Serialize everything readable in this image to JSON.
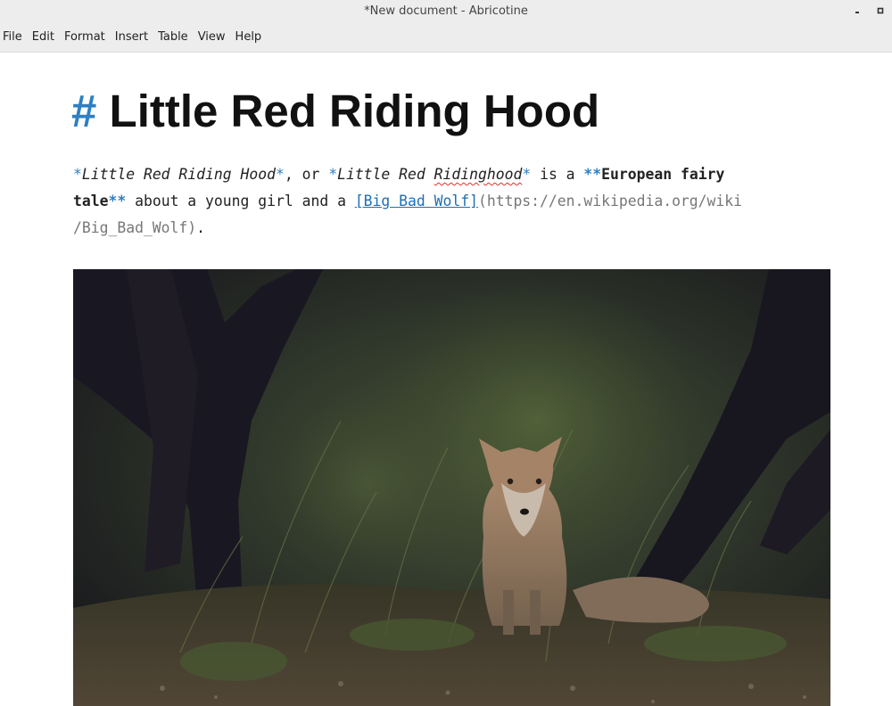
{
  "window": {
    "title": "*New document - Abricotine",
    "controls": [
      "minimize-icon",
      "maximize-icon"
    ]
  },
  "menu": {
    "items": [
      {
        "label": "File"
      },
      {
        "label": "Edit"
      },
      {
        "label": "Format"
      },
      {
        "label": "Insert"
      },
      {
        "label": "Table"
      },
      {
        "label": "View"
      },
      {
        "label": "Help"
      }
    ]
  },
  "document": {
    "heading": {
      "marker": "#",
      "text": "Little Red Riding Hood"
    },
    "paragraph": {
      "em1_open": "*",
      "em1_text": "Little Red Riding Hood",
      "em1_close": "*",
      "sep1": ", or ",
      "em2_open": "*",
      "em2_text_a": "Little Red ",
      "em2_text_b": "Ridinghood",
      "em2_close": "*",
      "mid1": " is a ",
      "strong_open": "**",
      "strong_text_a": "European fairy",
      "strong_text_b": "tale",
      "strong_close": "**",
      "mid2": " about a young girl and a ",
      "link_text": "[Big Bad Wolf]",
      "link_url_a": "(https://en.wikipedia.org/wiki",
      "link_url_b": "/Big_Bad_Wolf)",
      "end": "."
    },
    "image": {
      "subject": "fox-in-forest-photo"
    }
  },
  "colors": {
    "markdown_marker": "#2f7fc1",
    "link": "#1f6fb5",
    "spellcheck": "#e0312b",
    "chrome": "#ededed"
  }
}
